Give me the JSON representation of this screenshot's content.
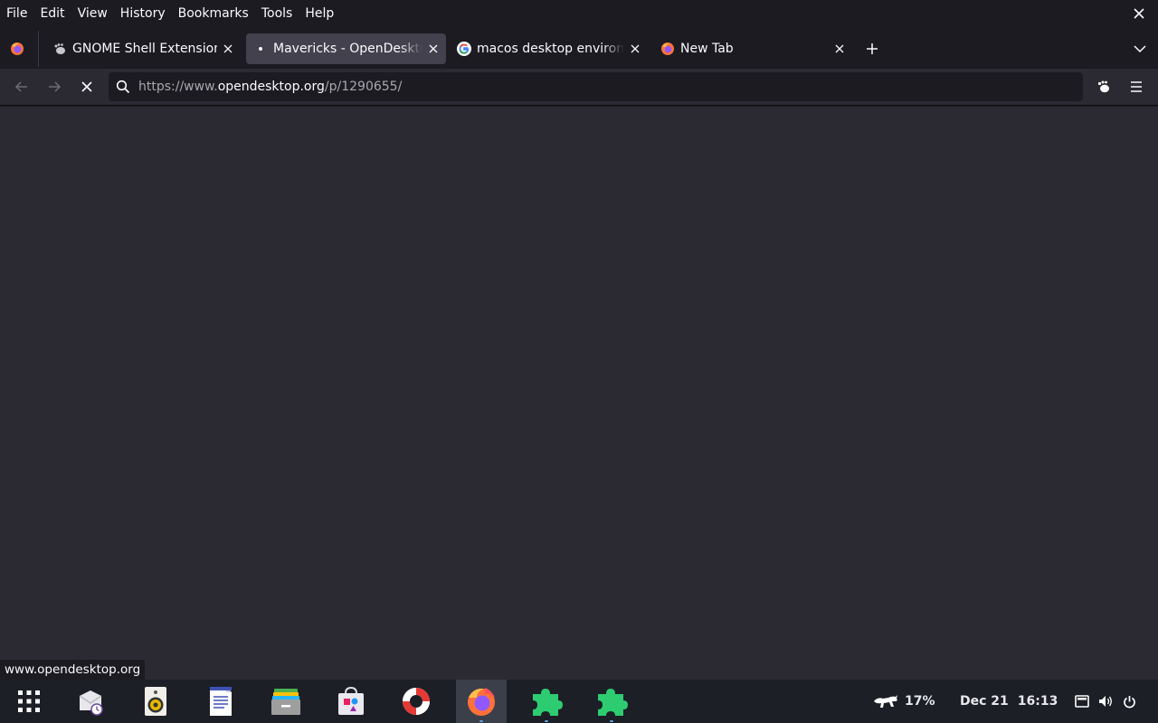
{
  "menubar": {
    "items": [
      "File",
      "Edit",
      "View",
      "History",
      "Bookmarks",
      "Tools",
      "Help"
    ]
  },
  "tabs": [
    {
      "label": "GNOME Shell Extensions",
      "icon": "gnome-foot-icon",
      "selected": false
    },
    {
      "label": "Mavericks - OpenDesktop",
      "icon": "loading-dot-icon",
      "selected": true
    },
    {
      "label": "macos desktop environment",
      "icon": "google-icon",
      "selected": false
    },
    {
      "label": "New Tab",
      "icon": "firefox-icon",
      "selected": false
    }
  ],
  "navbar": {
    "url_prefix": "https://www.",
    "url_host": "opendesktop.org",
    "url_path": "/p/1290655/"
  },
  "statuspanel": {
    "text": "www.opendesktop.org"
  },
  "taskbar": {
    "items": [
      "app-grid-icon",
      "mail-clock-icon",
      "speaker-icon",
      "text-document-icon",
      "file-archive-icon",
      "software-store-icon",
      "help-lifebuoy-icon",
      "firefox-icon",
      "puzzle-extension-icon",
      "puzzle-extension-icon"
    ],
    "active_item": "firefox-icon",
    "battery_percent": "17%",
    "date": "Dec 21",
    "time": "16:13"
  },
  "colors": {
    "chrome_bg": "#1c1b22",
    "toolbar_bg": "#2b2a33",
    "selected_tab": "#42414d",
    "taskbar_bg": "#1c1f26",
    "extension_green": "#2ecc71"
  }
}
